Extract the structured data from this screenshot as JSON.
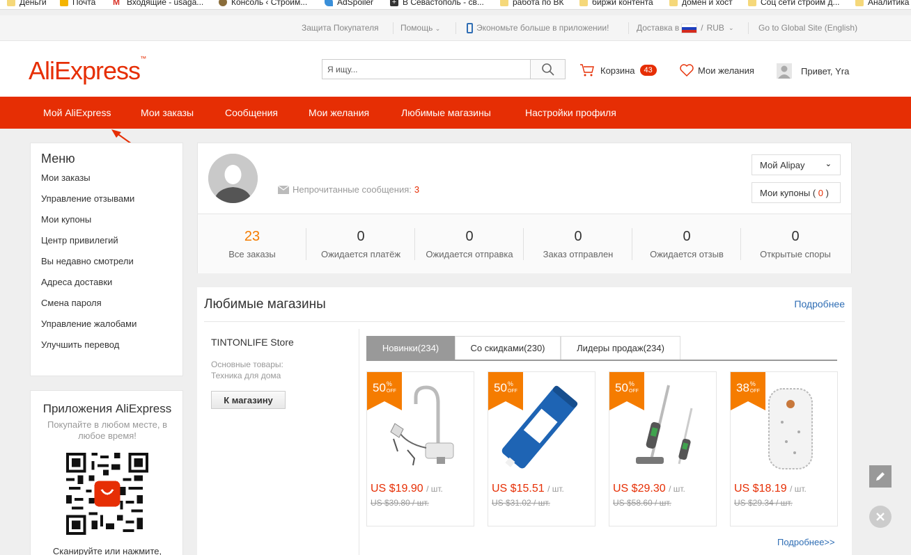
{
  "bookmarks": [
    {
      "label": "Деньги",
      "icon": "folder-icon"
    },
    {
      "label": "Почта",
      "icon": "mail-icon"
    },
    {
      "label": "Входящие - usaga...",
      "icon": "gmail-icon"
    },
    {
      "label": "Консоль ‹ Строим...",
      "icon": "wordpress-icon"
    },
    {
      "label": "AdSpoiler",
      "icon": "adspoiler-icon"
    },
    {
      "label": "В Севастополь - св...",
      "icon": "plus-icon"
    },
    {
      "label": "работа по ВК",
      "icon": "folder-icon"
    },
    {
      "label": "биржи контента",
      "icon": "folder-icon"
    },
    {
      "label": "домен и хост",
      "icon": "folder-icon"
    },
    {
      "label": "Соц сети строим д...",
      "icon": "folder-icon"
    },
    {
      "label": "Аналитика",
      "icon": "folder-icon"
    }
  ],
  "topbar": {
    "buyer_protection": "Защита Покупателя",
    "help": "Помощь",
    "app_promo": "Экономьте больше в приложении!",
    "ship_to": "Доставка в",
    "currency": "RUB",
    "global_site": "Go to Global Site (English)"
  },
  "header": {
    "logo": "AliExpress",
    "search_placeholder": "Я ищу...",
    "cart_label": "Корзина",
    "cart_count": "43",
    "wishlist_label": "Мои желания",
    "greeting": "Привет, Yra"
  },
  "nav": [
    "Мой AliExpress",
    "Мои заказы",
    "Сообщения",
    "Мои желания",
    "Любимые магазины",
    "Настройки профиля"
  ],
  "sidebar": {
    "title": "Меню",
    "items": [
      "Мои заказы",
      "Управление отзывами",
      "Мои купоны",
      "Центр привилегий",
      "Вы недавно смотрели",
      "Адреса доставки",
      "Смена пароля",
      "Управление жалобами",
      "Улучшить перевод"
    ]
  },
  "apps": {
    "title": "Приложения AliExpress",
    "subtitle": "Покупайте в любом месте, в любое время!",
    "scan": "Сканируйте или нажмите,"
  },
  "profile": {
    "unread_label": "Непрочитанные сообщения:",
    "unread_count": "3",
    "alipay": "Мой Alipay",
    "coupons_label": "Мои купоны (",
    "coupons_count": "0",
    "coupons_close": ")",
    "stats": [
      {
        "num": "23",
        "label": "Все заказы"
      },
      {
        "num": "0",
        "label": "Ожидается платёж"
      },
      {
        "num": "0",
        "label": "Ожидается отправка"
      },
      {
        "num": "0",
        "label": "Заказ отправлен"
      },
      {
        "num": "0",
        "label": "Ожидается отзыв"
      },
      {
        "num": "0",
        "label": "Открытые споры"
      }
    ]
  },
  "stores": {
    "title": "Любимые магазины",
    "more": "Подробнее",
    "store_name": "TINTONLIFE Store",
    "main_goods_label": "Основные товары:",
    "main_goods": "Техника для дома",
    "to_store": "К магазину",
    "tabs": [
      "Новинки(234)",
      "Со скидками(230)",
      "Лидеры продаж(234)"
    ],
    "products": [
      {
        "discount": "50",
        "off": "OFF",
        "price": "US $19.90",
        "unit": "/ шт.",
        "old": "US $39.80 / шт.",
        "icon": "faucet-heater-image"
      },
      {
        "discount": "50",
        "off": "OFF",
        "price": "US $15.51",
        "unit": "/ шт.",
        "old": "US $31.02 / шт.",
        "icon": "water-filter-membrane-image"
      },
      {
        "discount": "50",
        "off": "OFF",
        "price": "US $29.30",
        "unit": "/ шт.",
        "old": "US $58.60 / шт.",
        "icon": "stick-vacuum-image"
      },
      {
        "discount": "38",
        "off": "OFF",
        "price": "US $18.19",
        "unit": "/ шт.",
        "old": "US $29.34 / шт.",
        "icon": "heating-pad-image"
      }
    ],
    "more2": "Подробнее>>"
  },
  "colors": {
    "brand": "#e62e04",
    "discount": "#f57c00",
    "link": "#2e6db4"
  }
}
